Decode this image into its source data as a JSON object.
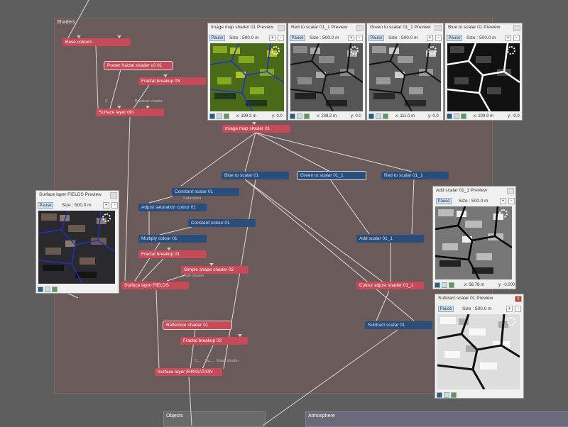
{
  "shaders_group": {
    "title": "Shaders"
  },
  "bottom_groups": {
    "objects": "Objects",
    "atmosphere": "Atmosphere"
  },
  "colors": {
    "shader_node": "#c64a57",
    "function_node": "#2a4e7c",
    "group_bg": "#6b5a5a"
  },
  "nodes": {
    "base_colours": "Base colours",
    "power_fractal": "Power fractal shader v3 01",
    "fractal_breakup_03": "Fractal breakup 03",
    "surface_layer_dirt": "Surface layer dirt",
    "image_map_shader": "Image map shader 01",
    "blue_to_scalar": "Blue to scalar 01",
    "green_to_scalar": "Green to scalar 01_1",
    "red_to_scalar": "Red to scalar 01_1",
    "constant_scalar": "Constant scalar 01",
    "adjust_saturation": "Adjust saturation colour 01",
    "constant_colour": "Constant colour 01",
    "multiply_colour": "Multiply colour 01",
    "fractal_breakup_01": "Fractal breakup 01",
    "simple_shape": "Simple shape shader 02",
    "surface_layer_fields": "Surface layer FIELDS",
    "add_scalar": "Add scalar 01_1",
    "colour_adjust": "Colour adjust shader 01_1",
    "subtract_scalar": "Subtract scalar 01",
    "reflective_shader": "Reflective shader 01",
    "fractal_breakup_02": "Fractal breakup 02",
    "surface_layer_irrigation": "Surface layer IRRIGATION"
  },
  "hints": {
    "c1": "C",
    "breakup_shader": "Breakup shader",
    "saturation": "Saturation",
    "mask_shader_1": "Mask shader",
    "c2": "C...",
    "bu": "Bu...",
    "mask_shader_2": "Mask shader"
  },
  "previews": {
    "pause": "Pause",
    "size_label": "Size : 500.0 m",
    "plus": "+",
    "minus": "-",
    "close": "x",
    "image_map": {
      "title": "Image map shader 01 Preview",
      "x": "x: 199.2 m",
      "y": "y: 0.0"
    },
    "red": {
      "title": "Red to scalar 01_1 Preview",
      "x": "x: 238.2 m",
      "y": "y: 0.0"
    },
    "green": {
      "title": "Green to scalar 01_1 Preview",
      "x": "x: 111.0 m",
      "y": "y: 0.0"
    },
    "blue": {
      "title": "Blue to scalar 01 Preview",
      "x": "x: 209.9 m",
      "y": "y: -0.0"
    },
    "fields": {
      "title": "Surface layer FIELDS Preview"
    },
    "add": {
      "title": "Add scalar 01_1 Preview",
      "x": "x: 56.78 m",
      "y": "y: -0.000"
    },
    "subtract": {
      "title": "Subtract scalar 01 Preview"
    }
  }
}
